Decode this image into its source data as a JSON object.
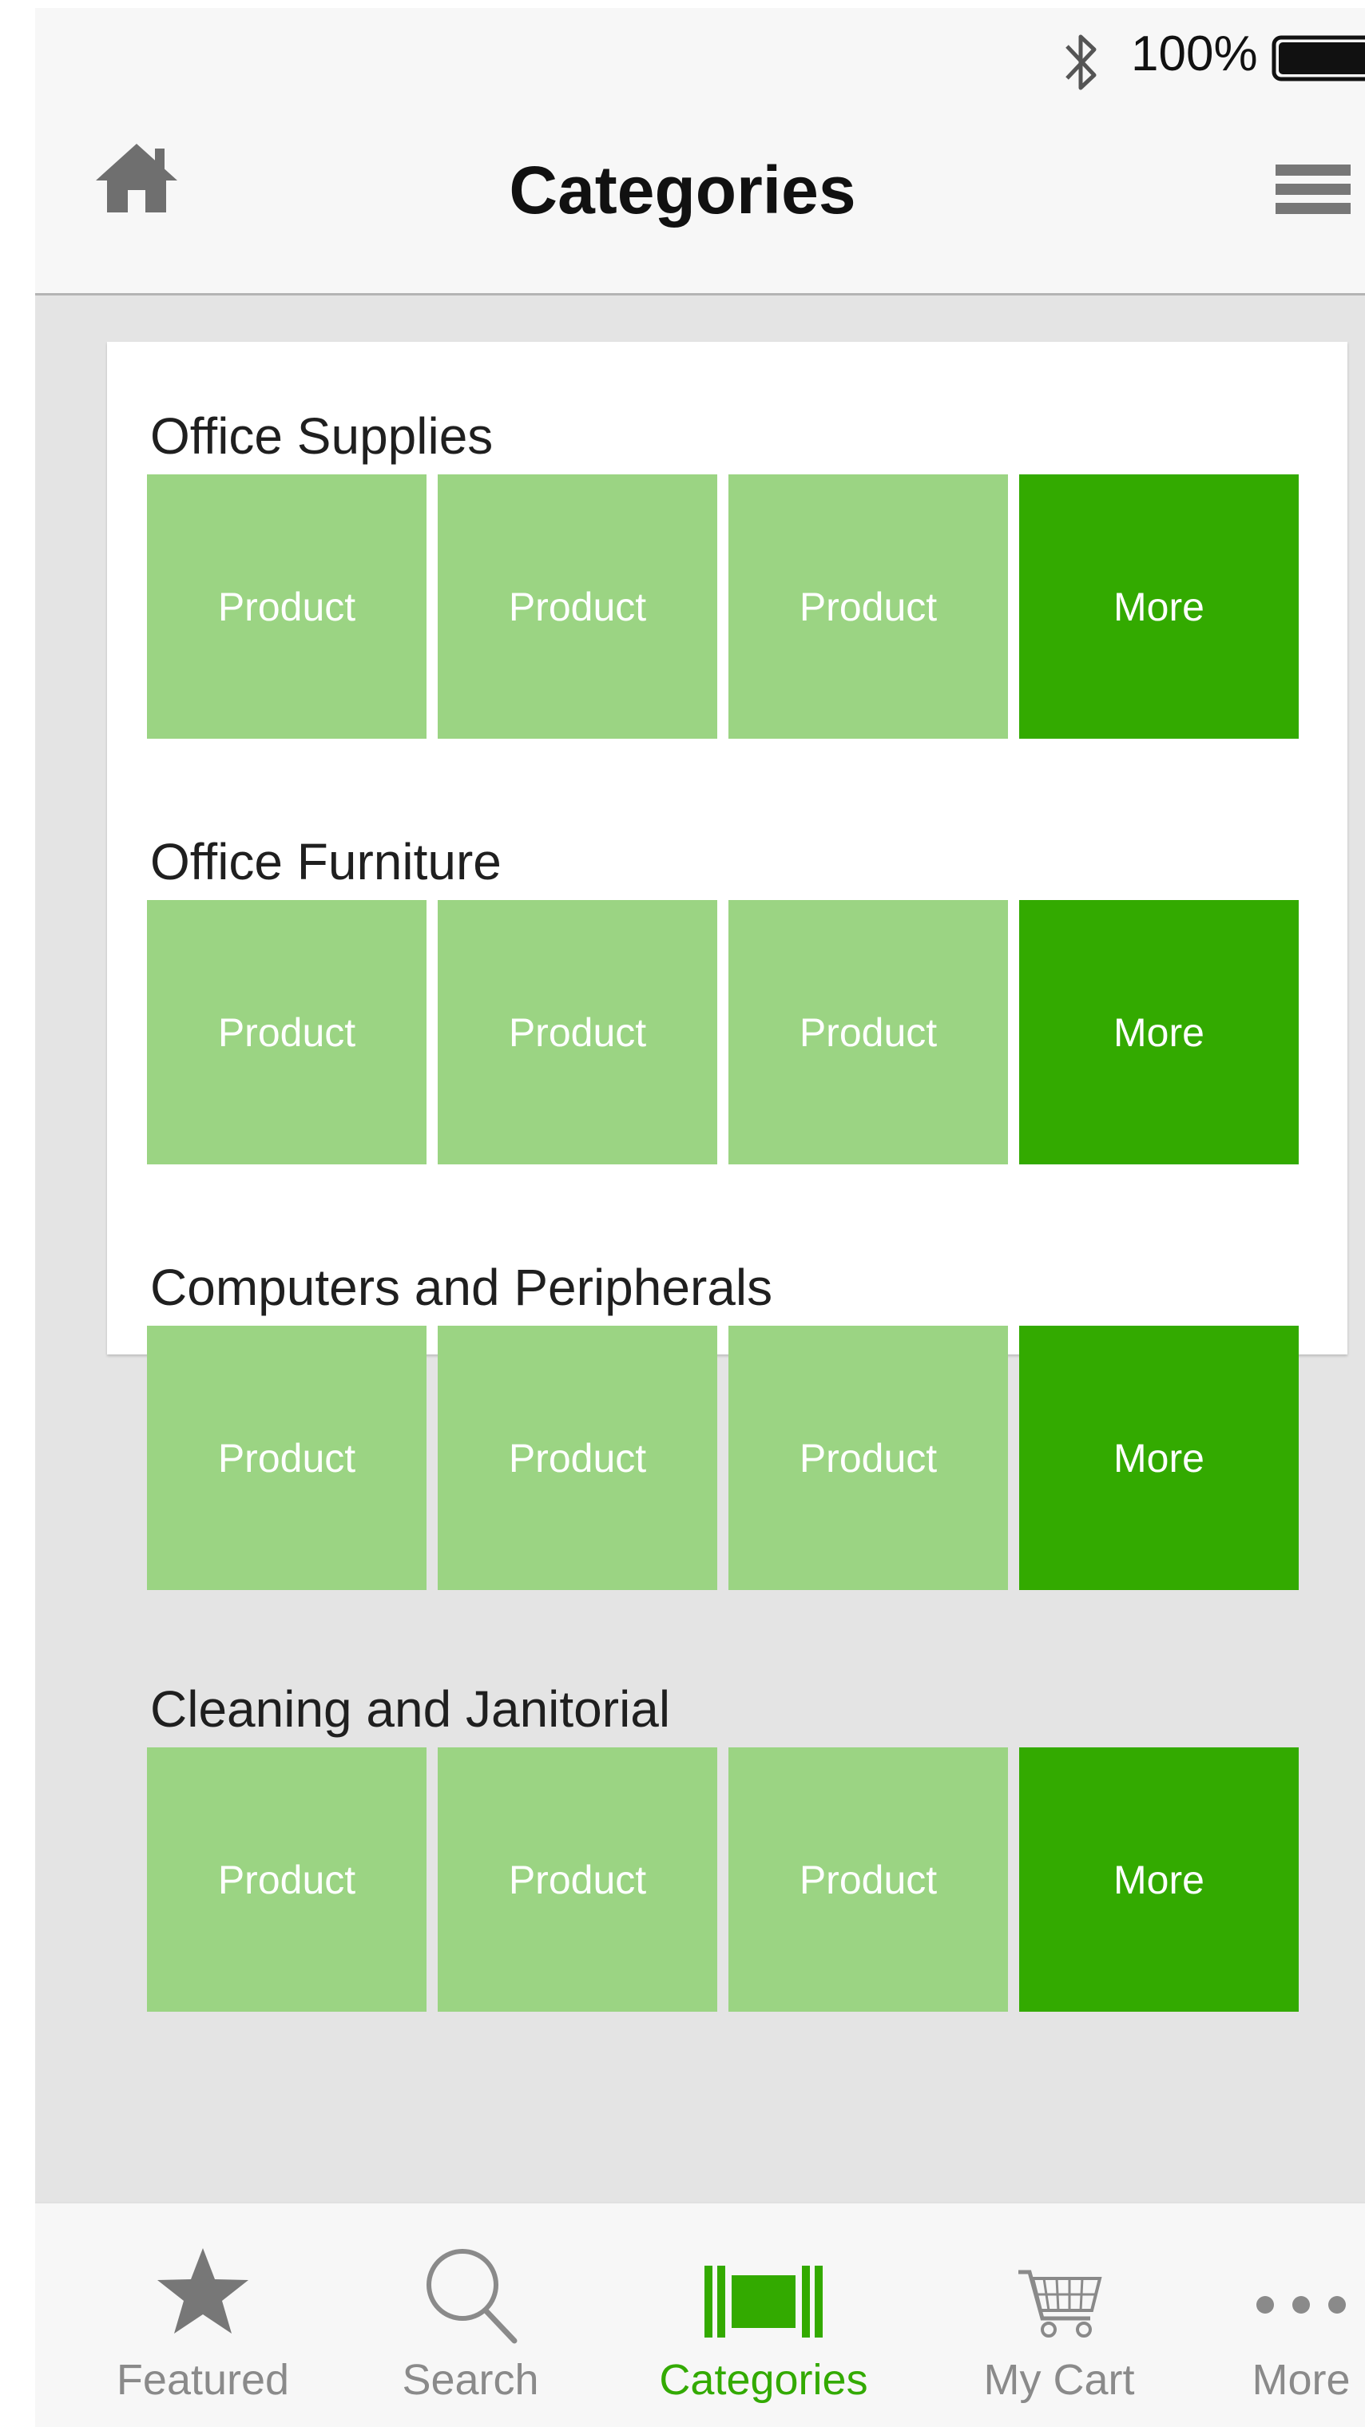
{
  "status_bar": {
    "battery_percent": "100%",
    "bluetooth_icon": "bluetooth-icon",
    "battery_icon": "battery-full-icon"
  },
  "nav": {
    "title": "Categories",
    "home_icon": "home-icon",
    "menu_icon": "hamburger-menu-icon"
  },
  "categories": [
    {
      "title": "Office Supplies",
      "tiles": [
        "Product",
        "Product",
        "Product"
      ],
      "more": "More"
    },
    {
      "title": "Office Furniture",
      "tiles": [
        "Product",
        "Product",
        "Product"
      ],
      "more": "More"
    },
    {
      "title": "Computers and Peripherals",
      "tiles": [
        "Product",
        "Product",
        "Product"
      ],
      "more": "More"
    },
    {
      "title": "Cleaning and Janitorial",
      "tiles": [
        "Product",
        "Product",
        "Product"
      ],
      "more": "More"
    }
  ],
  "tabs": [
    {
      "label": "Featured",
      "icon": "star-icon"
    },
    {
      "label": "Search",
      "icon": "search-icon"
    },
    {
      "label": "Categories",
      "icon": "categories-icon",
      "active": true
    },
    {
      "label": "My Cart",
      "icon": "cart-icon"
    },
    {
      "label": "More",
      "icon": "more-dots-icon"
    }
  ],
  "colors": {
    "product_tile": "#9bd483",
    "more_tile": "#33aa00",
    "accent": "#33aa00",
    "tab_inactive": "#8a8a8a"
  }
}
